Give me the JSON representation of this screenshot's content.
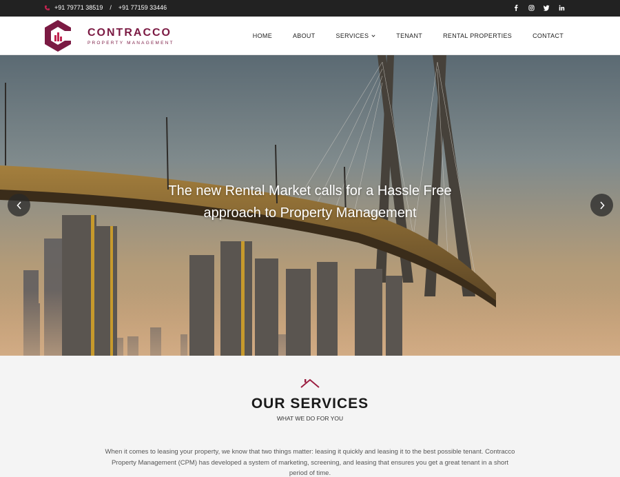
{
  "topbar": {
    "phone1": "+91 79771 38519",
    "separator": "/",
    "phone2": "+91 77159 33446",
    "social": [
      "facebook-icon",
      "instagram-icon",
      "twitter-icon",
      "linkedin-icon"
    ]
  },
  "brand": {
    "name": "CONTRACCO",
    "tagline": "PROPERTY MANAGEMENT",
    "color": "#7b1a43",
    "accent": "#c0234f"
  },
  "nav": {
    "items": [
      "HOME",
      "ABOUT",
      "SERVICES",
      "TENANT",
      "RENTAL PROPERTIES",
      "CONTACT"
    ]
  },
  "hero": {
    "line1": "The new Rental Market calls for a  Hassle Free",
    "line2": "approach to Property Management",
    "prev_icon": "chevron-left-icon",
    "next_icon": "chevron-right-icon"
  },
  "services": {
    "title": "OUR SERVICES",
    "subtitle": "WHAT WE DO FOR YOU",
    "body": "When it comes to leasing your property, we know that two things matter: leasing it quickly and leasing it to the best possible tenant. Contracco Property Management (CPM) has developed a system of marketing, screening, and leasing that ensures you get a great tenant in a short period of time."
  }
}
